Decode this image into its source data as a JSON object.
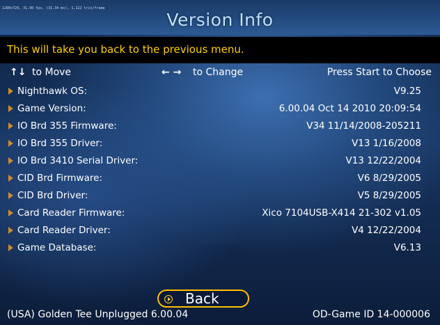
{
  "hud_text": "1280x720, 31.90 fps, (31.34 ms), 1,122 tris/frame",
  "title": "Version Info",
  "prompt": "This will take you back to the previous menu.",
  "controls": {
    "move_icon": "↑↓",
    "move": "to Move",
    "change_icon": "← →",
    "change": "to Change",
    "choose": "Press Start to Choose"
  },
  "items": [
    {
      "label": "Nighthawk OS:",
      "value": "V9.25"
    },
    {
      "label": "Game Version:",
      "value": "6.00.04 Oct 14 2010 20:09:54"
    },
    {
      "label": "IO Brd 355 Firmware:",
      "value": "V34 11/14/2008-205211"
    },
    {
      "label": "IO Brd 355 Driver:",
      "value": "V13 1/16/2008"
    },
    {
      "label": "IO Brd 3410 Serial Driver:",
      "value": "V13 12/22/2004"
    },
    {
      "label": "CID Brd Firmware:",
      "value": "V6 8/29/2005"
    },
    {
      "label": "CID Brd Driver:",
      "value": "V5 8/29/2005"
    },
    {
      "label": "Card Reader Firmware:",
      "value": "Xico 7104USB-X414 21-302 v1.05"
    },
    {
      "label": "Card Reader Driver:",
      "value": "V4 12/22/2004"
    },
    {
      "label": "Game Database:",
      "value": "V6.13"
    }
  ],
  "back_label": "Back",
  "footer": {
    "left": "(USA) Golden Tee Unplugged 6.00.04",
    "right": "OD-Game ID 14-000006"
  },
  "colors": {
    "prompt": "#ffd000",
    "marker": "#d18a2a",
    "back_border": "#ffc000"
  }
}
